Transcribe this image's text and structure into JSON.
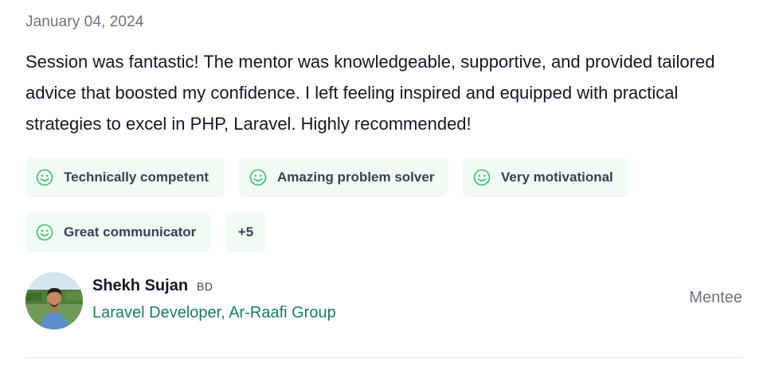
{
  "review": {
    "date": "January 04, 2024",
    "text": "Session was fantastic! The mentor was knowledgeable, supportive, and provided tailored advice that boosted my confidence. I left feeling inspired and equipped with practical strategies to excel in PHP, Laravel. Highly recommended!",
    "tags": [
      {
        "label": "Technically competent",
        "icon": "smile-icon"
      },
      {
        "label": "Amazing problem solver",
        "icon": "smile-icon"
      },
      {
        "label": "Very motivational",
        "icon": "smile-icon"
      },
      {
        "label": "Great communicator",
        "icon": "smile-icon"
      }
    ],
    "more_tags_label": "+5",
    "reviewer": {
      "name": "Shekh Sujan",
      "country": "BD",
      "job": "Laravel Developer, Ar-Raafi Group",
      "role": "Mentee"
    }
  },
  "colors": {
    "tag_background": "#f1fbf4",
    "icon_green": "#34c46a",
    "job_link": "#177b6a",
    "muted_text": "#6b7280"
  }
}
